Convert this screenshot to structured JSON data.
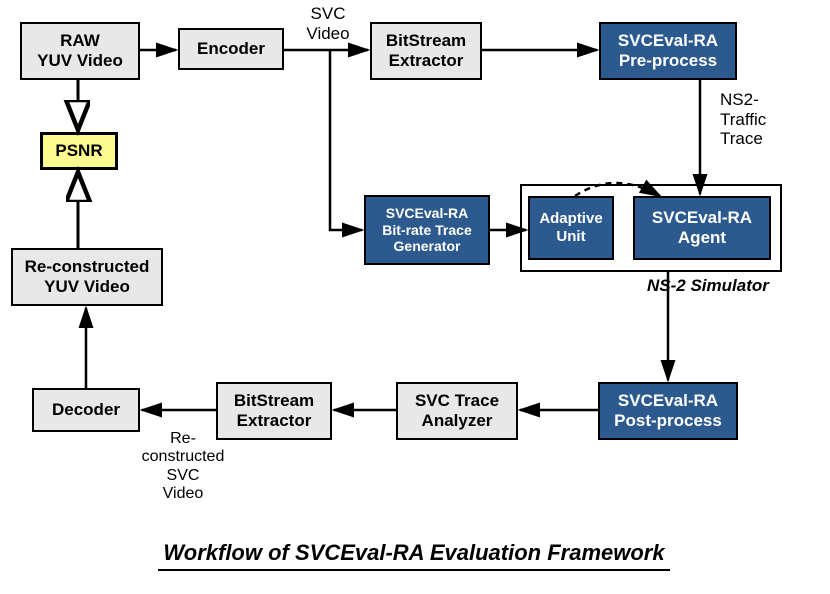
{
  "nodes": {
    "raw": "RAW\nYUV Video",
    "encoder": "Encoder",
    "bitstream1": "BitStream\nExtractor",
    "preprocess": "SVCEval-RA\nPre-process",
    "psnr": "PSNR",
    "bitrateGen": "SVCEval-RA\nBit-rate Trace\nGenerator",
    "adaptive": "Adaptive\nUnit",
    "agent": "SVCEval-RA\nAgent",
    "reconstructed": "Re-constructed\nYUV Video",
    "decoder": "Decoder",
    "bitstream2": "BitStream\nExtractor",
    "svcAnalyzer": "SVC Trace\nAnalyzer",
    "postprocess": "SVCEval-RA\nPost-process"
  },
  "labels": {
    "svcVideo": "SVC\nVideo",
    "ns2Traffic": "NS2-\nTraffic\nTrace",
    "ns2Sim": "NS-2 Simulator",
    "reconSvc": "Re-\nconstructed\nSVC\nVideo"
  },
  "caption": "Workflow of SVCEval-RA Evaluation Framework"
}
